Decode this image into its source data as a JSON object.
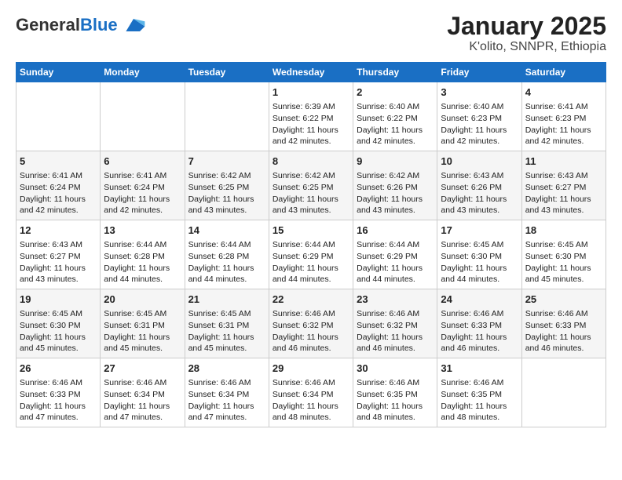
{
  "header": {
    "logo_general": "General",
    "logo_blue": "Blue",
    "title": "January 2025",
    "subtitle": "K'olito, SNNPR, Ethiopia"
  },
  "days_of_week": [
    "Sunday",
    "Monday",
    "Tuesday",
    "Wednesday",
    "Thursday",
    "Friday",
    "Saturday"
  ],
  "weeks": [
    [
      {
        "day": "",
        "info": ""
      },
      {
        "day": "",
        "info": ""
      },
      {
        "day": "",
        "info": ""
      },
      {
        "day": "1",
        "info": "Sunrise: 6:39 AM\nSunset: 6:22 PM\nDaylight: 11 hours and 42 minutes."
      },
      {
        "day": "2",
        "info": "Sunrise: 6:40 AM\nSunset: 6:22 PM\nDaylight: 11 hours and 42 minutes."
      },
      {
        "day": "3",
        "info": "Sunrise: 6:40 AM\nSunset: 6:23 PM\nDaylight: 11 hours and 42 minutes."
      },
      {
        "day": "4",
        "info": "Sunrise: 6:41 AM\nSunset: 6:23 PM\nDaylight: 11 hours and 42 minutes."
      }
    ],
    [
      {
        "day": "5",
        "info": "Sunrise: 6:41 AM\nSunset: 6:24 PM\nDaylight: 11 hours and 42 minutes."
      },
      {
        "day": "6",
        "info": "Sunrise: 6:41 AM\nSunset: 6:24 PM\nDaylight: 11 hours and 42 minutes."
      },
      {
        "day": "7",
        "info": "Sunrise: 6:42 AM\nSunset: 6:25 PM\nDaylight: 11 hours and 43 minutes."
      },
      {
        "day": "8",
        "info": "Sunrise: 6:42 AM\nSunset: 6:25 PM\nDaylight: 11 hours and 43 minutes."
      },
      {
        "day": "9",
        "info": "Sunrise: 6:42 AM\nSunset: 6:26 PM\nDaylight: 11 hours and 43 minutes."
      },
      {
        "day": "10",
        "info": "Sunrise: 6:43 AM\nSunset: 6:26 PM\nDaylight: 11 hours and 43 minutes."
      },
      {
        "day": "11",
        "info": "Sunrise: 6:43 AM\nSunset: 6:27 PM\nDaylight: 11 hours and 43 minutes."
      }
    ],
    [
      {
        "day": "12",
        "info": "Sunrise: 6:43 AM\nSunset: 6:27 PM\nDaylight: 11 hours and 43 minutes."
      },
      {
        "day": "13",
        "info": "Sunrise: 6:44 AM\nSunset: 6:28 PM\nDaylight: 11 hours and 44 minutes."
      },
      {
        "day": "14",
        "info": "Sunrise: 6:44 AM\nSunset: 6:28 PM\nDaylight: 11 hours and 44 minutes."
      },
      {
        "day": "15",
        "info": "Sunrise: 6:44 AM\nSunset: 6:29 PM\nDaylight: 11 hours and 44 minutes."
      },
      {
        "day": "16",
        "info": "Sunrise: 6:44 AM\nSunset: 6:29 PM\nDaylight: 11 hours and 44 minutes."
      },
      {
        "day": "17",
        "info": "Sunrise: 6:45 AM\nSunset: 6:30 PM\nDaylight: 11 hours and 44 minutes."
      },
      {
        "day": "18",
        "info": "Sunrise: 6:45 AM\nSunset: 6:30 PM\nDaylight: 11 hours and 45 minutes."
      }
    ],
    [
      {
        "day": "19",
        "info": "Sunrise: 6:45 AM\nSunset: 6:30 PM\nDaylight: 11 hours and 45 minutes."
      },
      {
        "day": "20",
        "info": "Sunrise: 6:45 AM\nSunset: 6:31 PM\nDaylight: 11 hours and 45 minutes."
      },
      {
        "day": "21",
        "info": "Sunrise: 6:45 AM\nSunset: 6:31 PM\nDaylight: 11 hours and 45 minutes."
      },
      {
        "day": "22",
        "info": "Sunrise: 6:46 AM\nSunset: 6:32 PM\nDaylight: 11 hours and 46 minutes."
      },
      {
        "day": "23",
        "info": "Sunrise: 6:46 AM\nSunset: 6:32 PM\nDaylight: 11 hours and 46 minutes."
      },
      {
        "day": "24",
        "info": "Sunrise: 6:46 AM\nSunset: 6:33 PM\nDaylight: 11 hours and 46 minutes."
      },
      {
        "day": "25",
        "info": "Sunrise: 6:46 AM\nSunset: 6:33 PM\nDaylight: 11 hours and 46 minutes."
      }
    ],
    [
      {
        "day": "26",
        "info": "Sunrise: 6:46 AM\nSunset: 6:33 PM\nDaylight: 11 hours and 47 minutes."
      },
      {
        "day": "27",
        "info": "Sunrise: 6:46 AM\nSunset: 6:34 PM\nDaylight: 11 hours and 47 minutes."
      },
      {
        "day": "28",
        "info": "Sunrise: 6:46 AM\nSunset: 6:34 PM\nDaylight: 11 hours and 47 minutes."
      },
      {
        "day": "29",
        "info": "Sunrise: 6:46 AM\nSunset: 6:34 PM\nDaylight: 11 hours and 48 minutes."
      },
      {
        "day": "30",
        "info": "Sunrise: 6:46 AM\nSunset: 6:35 PM\nDaylight: 11 hours and 48 minutes."
      },
      {
        "day": "31",
        "info": "Sunrise: 6:46 AM\nSunset: 6:35 PM\nDaylight: 11 hours and 48 minutes."
      },
      {
        "day": "",
        "info": ""
      }
    ]
  ]
}
